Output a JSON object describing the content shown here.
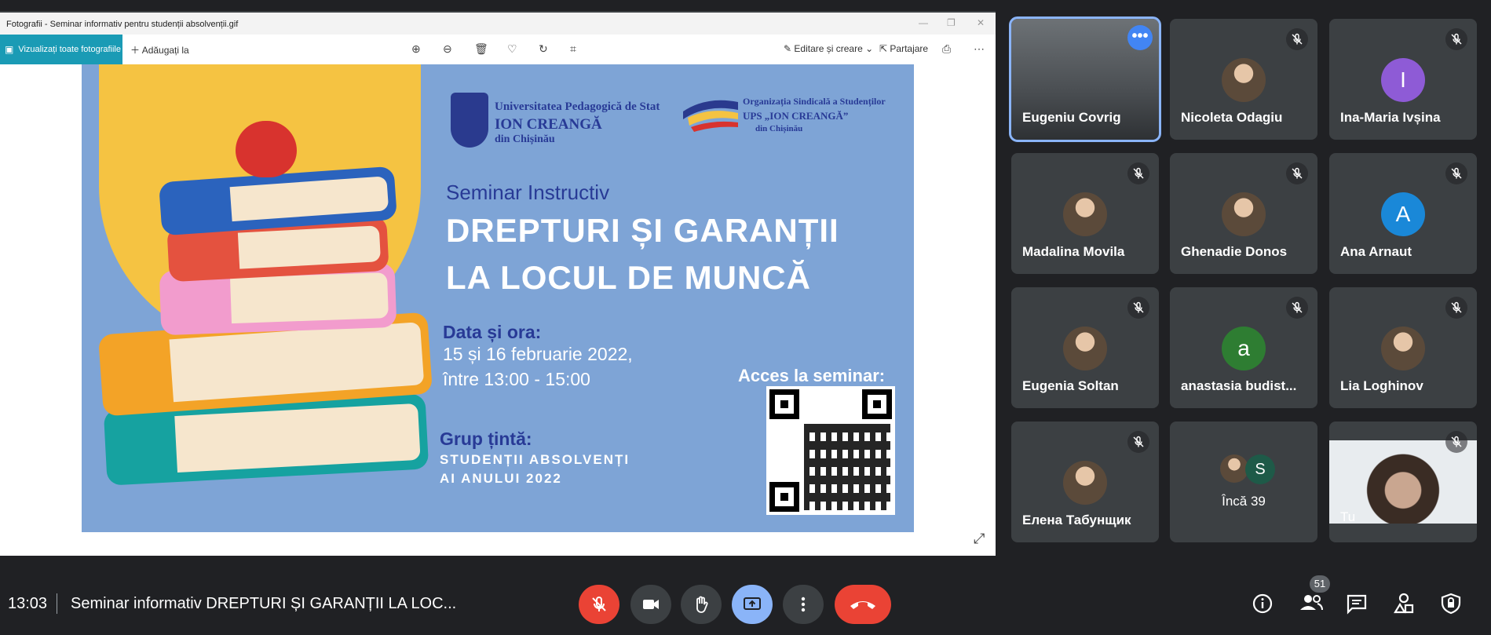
{
  "viewer": {
    "window_title": "Fotografii - Seminar informativ pentru studenții absolvenții.gif",
    "view_all_label": "Vizualizați toate fotografiile",
    "add_to_label": "Adăugați la",
    "edit_create_label": "Editare și creare",
    "share_label": "Partajare"
  },
  "poster": {
    "uni_line1": "Universitatea Pedagogică de Stat",
    "uni_line2": "ION CREANGĂ",
    "uni_line3": "din Chișinău",
    "org_line1": "Organizația Sindicală a Studenților",
    "org_line2": "UPS „ION CREANGĂ”",
    "org_line3": "din Chișinău",
    "subtitle": "Seminar Instructiv",
    "title_line1": "DREPTURI ȘI GARANȚII",
    "title_line2": "LA LOCUL DE MUNCĂ",
    "date_label": "Data și ora:",
    "date_line1": "15 și 16 februarie 2022,",
    "date_line2": "între 13:00 - 15:00",
    "target_label": "Grup țintă:",
    "target_line1": "STUDENȚII ABSOLVENȚI",
    "target_line2": "AI ANULUI 2022",
    "access_label": "Acces la seminar:"
  },
  "participants": [
    {
      "name": "Eugeniu Covrig",
      "avatar": "video",
      "muted": false
    },
    {
      "name": "Nicoleta Odagiu",
      "avatar": "photo",
      "muted": true
    },
    {
      "name": "Ina-Maria Ivșina",
      "avatar": "I",
      "color": "#8e5bd6",
      "muted": true
    },
    {
      "name": "Madalina Movila",
      "avatar": "photo",
      "muted": true
    },
    {
      "name": "Ghenadie Donos",
      "avatar": "photo",
      "muted": true
    },
    {
      "name": "Ana Arnaut",
      "avatar": "A",
      "color": "#1a88d8",
      "muted": true
    },
    {
      "name": "Eugenia Soltan",
      "avatar": "photo",
      "muted": true
    },
    {
      "name": "anastasia budist...",
      "avatar": "a",
      "color": "#2e7d32",
      "muted": true
    },
    {
      "name": "Lia Loghinov",
      "avatar": "photo",
      "muted": true
    },
    {
      "name": "Елена Табунщик",
      "avatar": "photo",
      "muted": true
    },
    {
      "name": "Încă 39",
      "avatar": "S",
      "color": "#1e5a48",
      "muted": false
    },
    {
      "name": "Tu",
      "avatar": "video",
      "muted": true
    }
  ],
  "bottom_bar": {
    "time": "13:03",
    "meeting_title": "Seminar informativ DREPTURI ȘI GARANȚII LA LOC...",
    "participant_count": "51"
  },
  "colors": {
    "background": "#202124",
    "tile": "#3c4043",
    "end_call": "#ea4335",
    "present_active": "#8ab4f8",
    "active_speaker_border": "#8ab4f8"
  }
}
